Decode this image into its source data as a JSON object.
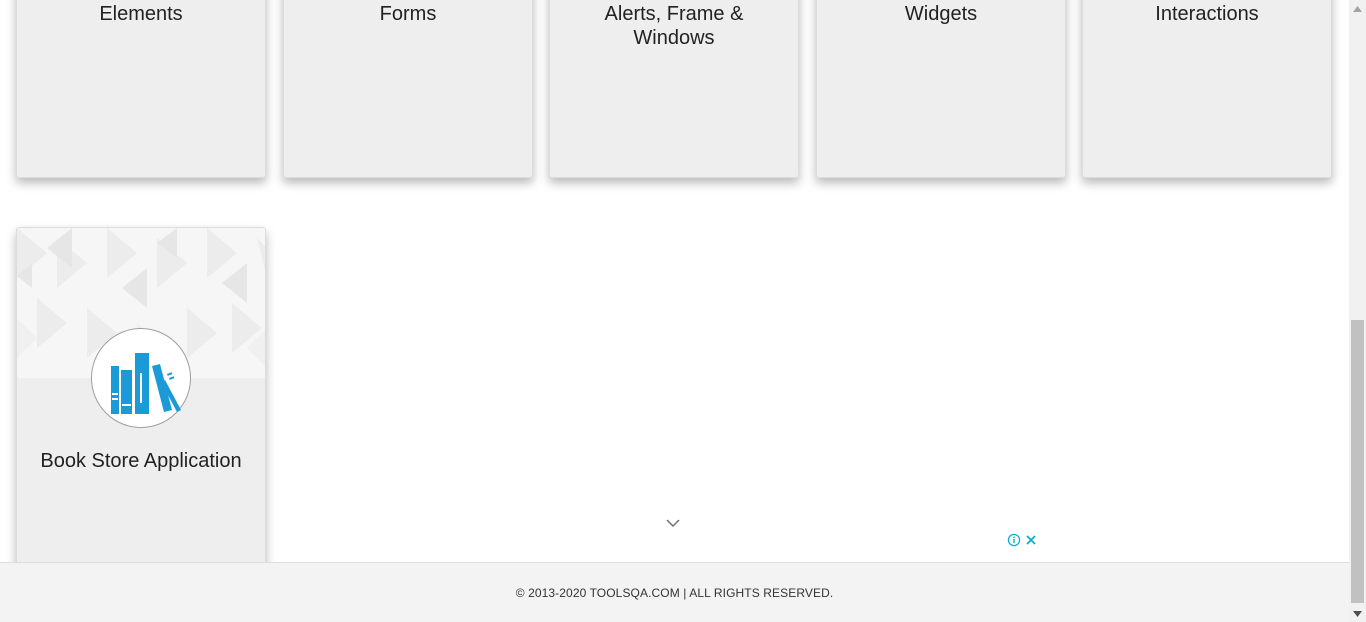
{
  "categories": [
    {
      "label": "Elements"
    },
    {
      "label": "Forms"
    },
    {
      "label": "Alerts, Frame & Windows"
    },
    {
      "label": "Widgets"
    },
    {
      "label": "Interactions"
    }
  ],
  "book_store": {
    "label": "Book Store Application",
    "icon": "bookshelf-icon"
  },
  "ad": {
    "info_icon": "info-icon",
    "close_icon": "close-icon",
    "expand_icon": "chevron-down-icon"
  },
  "footer": {
    "copyright": "© 2013-2020 TOOLSQA.COM | ALL RIGHTS RESERVED."
  },
  "colors": {
    "card_bg": "#eeeeee",
    "accent_blue": "#1b9ad8",
    "ad_teal": "#00aecd",
    "footer_bg": "#f3f3f3"
  }
}
